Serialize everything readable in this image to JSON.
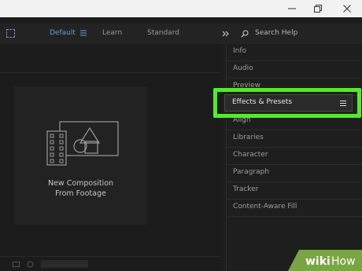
{
  "window_controls": {
    "minimize_icon": "minimize-icon",
    "maximize_icon": "restore-icon",
    "close_icon": "close-icon"
  },
  "toolbar": {
    "tabs": [
      {
        "label": "Default",
        "active": true
      },
      {
        "label": "Learn",
        "active": false
      },
      {
        "label": "Standard",
        "active": false
      }
    ],
    "search_label": "Search Help"
  },
  "composition": {
    "line1": "New Composition",
    "line2": "From Footage"
  },
  "panels": [
    {
      "label": "Info"
    },
    {
      "label": "Audio"
    },
    {
      "label": "Preview"
    },
    {
      "label": "Effects & Presets"
    },
    {
      "label": "Align"
    },
    {
      "label": "Libraries"
    },
    {
      "label": "Character"
    },
    {
      "label": "Paragraph"
    },
    {
      "label": "Tracker"
    },
    {
      "label": "Content-Aware Fill"
    }
  ],
  "colors": {
    "accent_blue": "#5f9ee0",
    "highlight_green": "#4cf021",
    "background": "#1d1d1d"
  }
}
